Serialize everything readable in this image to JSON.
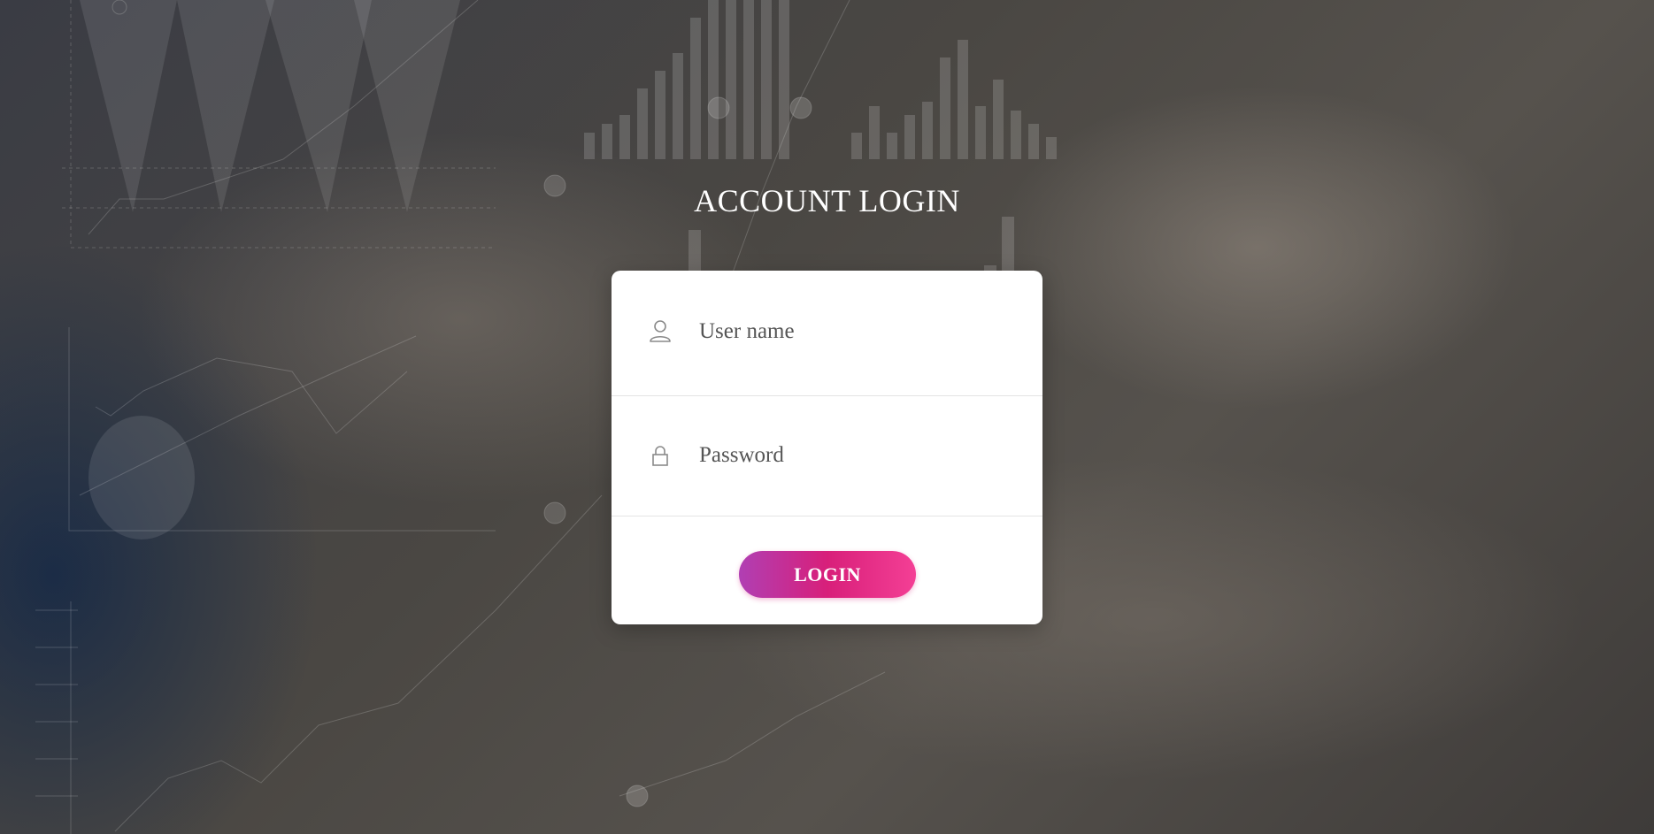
{
  "page": {
    "title": "ACCOUNT LOGIN"
  },
  "form": {
    "username": {
      "placeholder": "User name",
      "value": "",
      "icon": "user-icon"
    },
    "password": {
      "placeholder": "Password",
      "value": "",
      "icon": "lock-icon"
    },
    "login_label": "LOGIN"
  },
  "theme": {
    "card_bg": "#ffffff",
    "button_gradient_start": "#b03fb3",
    "button_gradient_mid": "#d81f7a",
    "button_gradient_end": "#f43f95",
    "title_color": "#ffffff"
  }
}
